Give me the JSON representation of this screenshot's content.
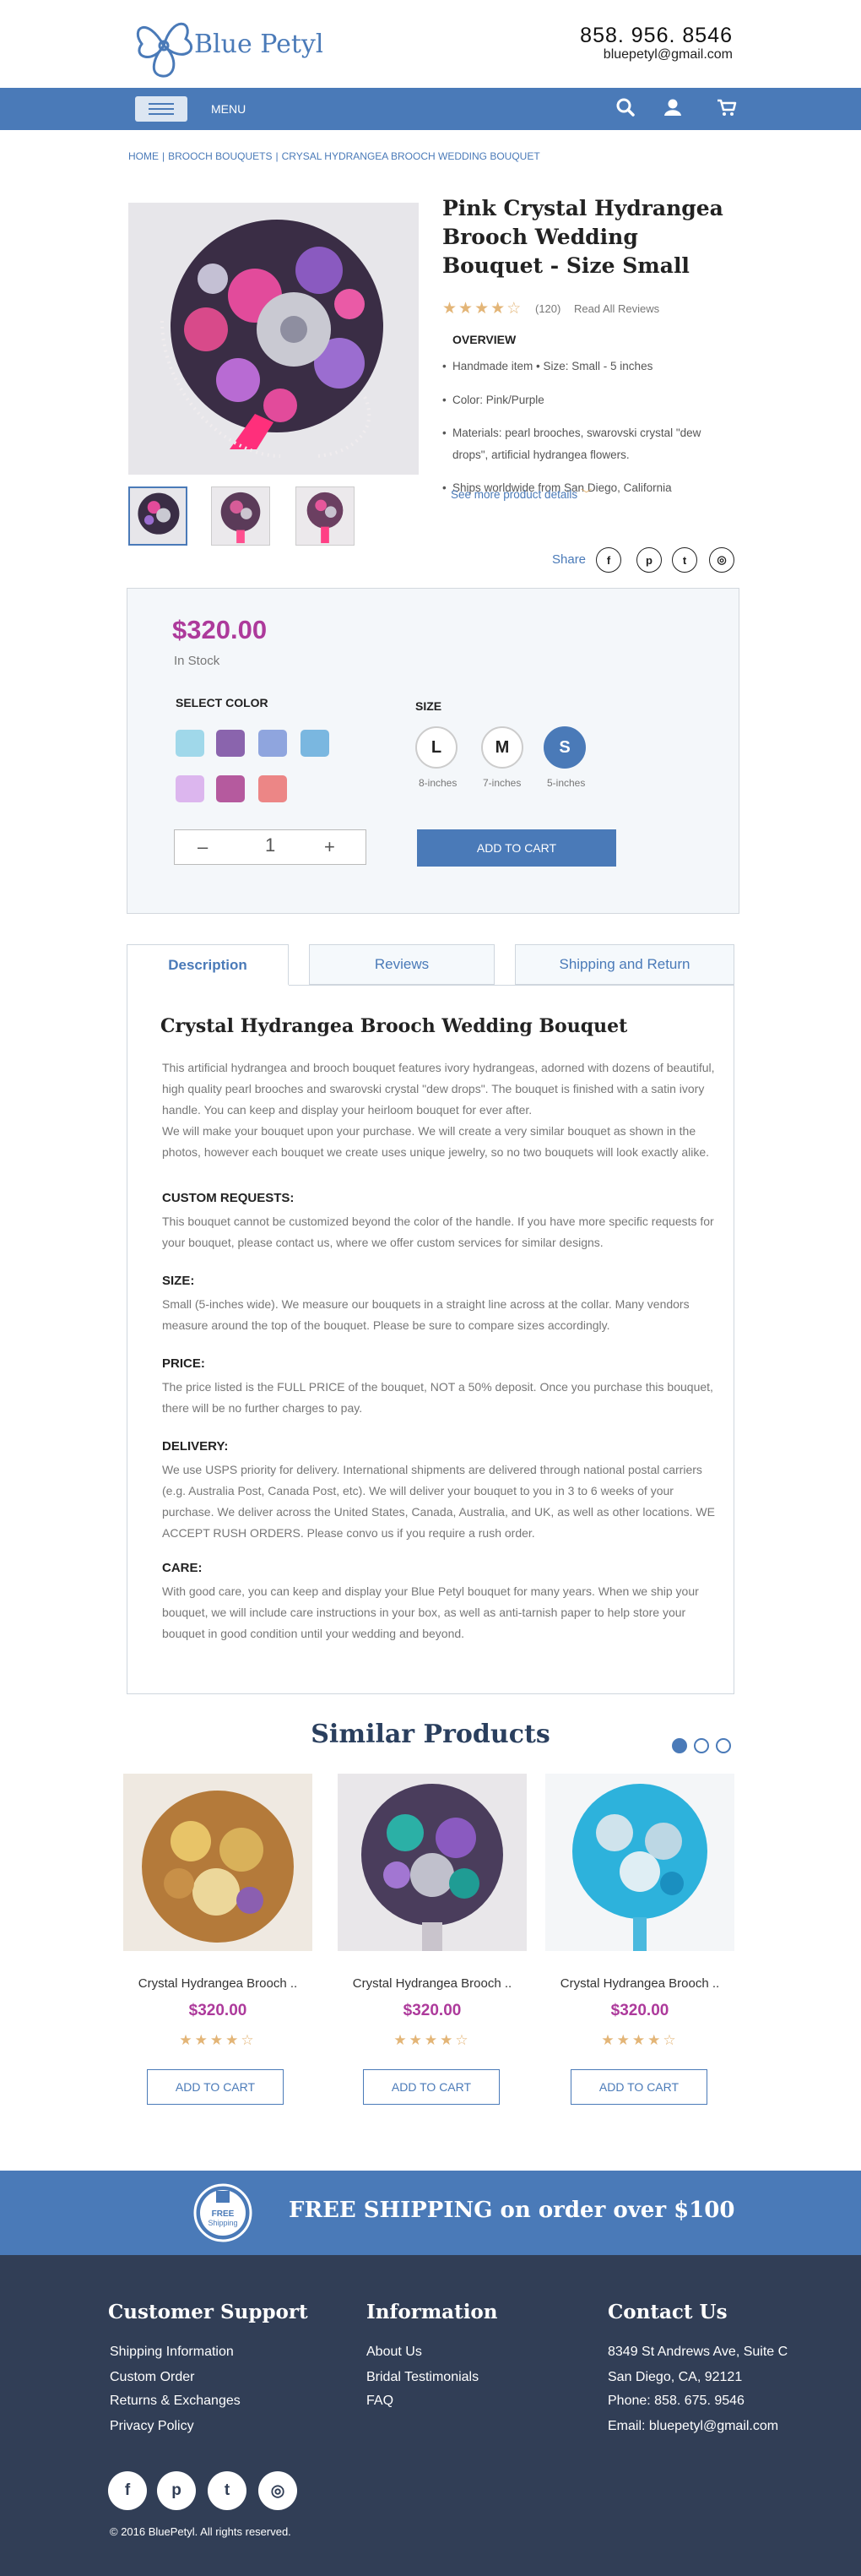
{
  "header": {
    "logo_text": "Blue Petyl",
    "phone": "858. 956. 8546",
    "email": "bluepetyl@gmail.com"
  },
  "nav": {
    "menu_label": "MENU",
    "icons": [
      "search-icon",
      "user-icon",
      "cart-icon"
    ]
  },
  "breadcrumb": [
    "HOME",
    "|",
    "BROOCH BOUQUETS",
    "|",
    "CRYSAL HYDRANGEA BROOCH WEDDING BOUQUET"
  ],
  "product": {
    "title": "Pink Crystal Hydrangea Brooch Wedding Bouquet - Size Small",
    "rating": 4,
    "review_count": "(120)",
    "read_reviews": "Read All Reviews",
    "overview_title": "OVERVIEW",
    "overview": [
      "Handmade item  •  Size: Small - 5 inches",
      "Color: Pink/Purple",
      "Materials: pearl brooches, swarovski crystal \"dew drops\", artificial hydrangea  flowers.",
      "Ships worldwide from San Diego, California"
    ],
    "see_more": "See more product details",
    "share_label": "Share"
  },
  "buy_box": {
    "price": "$320.00",
    "stock": "In Stock",
    "select_color_label": "SELECT COLOR",
    "swatches": [
      "#a0d8ea",
      "#8a64ad",
      "#8fa5de",
      "#7ab7e0",
      "#dcb6ee",
      "#b55a9e",
      "#ec8686"
    ],
    "size_label": "SIZE",
    "sizes": [
      {
        "label": "L",
        "caption": "8-inches",
        "selected": false
      },
      {
        "label": "M",
        "caption": "7-inches",
        "selected": false
      },
      {
        "label": "S",
        "caption": "5-inches",
        "selected": true
      }
    ],
    "qty_minus": "–",
    "qty_value": "1",
    "qty_plus": "+",
    "add_to_cart": "ADD TO CART"
  },
  "tabs": {
    "labels": [
      "Description",
      "Reviews",
      "Shipping and Return"
    ],
    "active": "Description"
  },
  "description": {
    "title": "Crystal Hydrangea Brooch Wedding Bouquet",
    "intro": "This artificial hydrangea and brooch bouquet features ivory hydrangeas, adorned with dozens of beautiful, high quality pearl brooches and swarovski crystal \"dew drops\". The bouquet is finished with a satin ivory handle. You can keep and display your heirloom bouquet for ever after.\nWe will make your bouquet upon your purchase. We will create a very similar bouquet as shown in the photos, however each bouquet we create uses unique jewelry, so no two bouquets will look exactly alike.",
    "sections": [
      {
        "heading": "CUSTOM REQUESTS:",
        "text": "This bouquet cannot be customized beyond the color of the handle. If you have more specific requests for your bouquet, please contact us, where we offer custom services for similar designs."
      },
      {
        "heading": "SIZE:",
        "text": "Small (5-inches wide). We measure our bouquets in a straight line across at the collar. Many vendors measure around the top of the bouquet. Please be sure to compare sizes accordingly."
      },
      {
        "heading": "PRICE:",
        "text": "The price listed is the FULL PRICE of the bouquet, NOT a 50% deposit. Once you purchase this bouquet, there will be no further charges to pay."
      },
      {
        "heading": "DELIVERY:",
        "text": "We use USPS priority for delivery. International shipments are delivered through national postal carriers (e.g. Australia Post, Canada Post, etc). We will deliver your bouquet to you in 3 to 6 weeks of your purchase. We deliver across the United States, Canada, Australia, and UK, as well as other locations. WE ACCEPT RUSH ORDERS. Please convo us if you require a rush order."
      },
      {
        "heading": "CARE:",
        "text": "With good care, you can keep and display your Blue Petyl bouquet for many years. When we ship your bouquet, we will include care instructions in your box, as well as anti-tarnish paper to help store your bouquet in good condition until your wedding and beyond."
      }
    ]
  },
  "similar": {
    "title": "Similar Products",
    "carousel_active": 1,
    "items": [
      {
        "name": "Crystal Hydrangea Brooch ..",
        "price": "$320.00",
        "rating": 4,
        "cart": "ADD TO CART"
      },
      {
        "name": "Crystal Hydrangea Brooch ..",
        "price": "$320.00",
        "rating": 4,
        "cart": "ADD TO CART"
      },
      {
        "name": "Crystal Hydrangea Brooch ..",
        "price": "$320.00",
        "rating": 4,
        "cart": "ADD TO CART"
      }
    ]
  },
  "shipping_banner": {
    "badge": "FREE Shipping",
    "text": "FREE SHIPPING on order over $100"
  },
  "footer": {
    "support_title": "Customer Support",
    "support_links": [
      "Shipping Information",
      "Custom Order",
      "Returns & Exchanges",
      "Privacy Policy"
    ],
    "info_title": "Information",
    "info_links": [
      "About Us",
      "Bridal Testimonials",
      "FAQ"
    ],
    "contact_title": "Contact Us",
    "contact_lines": [
      "8349 St Andrews Ave, Suite C",
      "San Diego, CA, 92121",
      "Phone: 858. 675. 9546",
      "Email: bluepetyl@gmail.com"
    ],
    "social_icons": [
      "facebook-icon",
      "pinterest-icon",
      "twitter-icon",
      "instagram-icon"
    ],
    "copyright": "© 2016 BluePetyl. All rights reserved."
  },
  "colors": {
    "brand_blue": "#4a7ab8",
    "price_magenta": "#ad3a9b",
    "footer_navy": "#313e56",
    "star_gold": "#e3b577"
  }
}
